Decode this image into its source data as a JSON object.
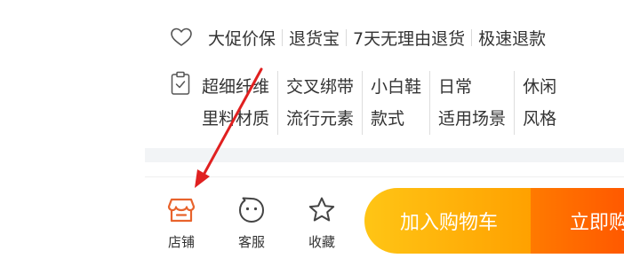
{
  "guarantees": {
    "items": [
      "大促价保",
      "退货宝",
      "7天无理由退货",
      "极速退款"
    ]
  },
  "attributes": [
    {
      "value": "超细纤维",
      "name": "里料材质"
    },
    {
      "value": "交叉绑带",
      "name": "流行元素"
    },
    {
      "value": "小白鞋",
      "name": "款式"
    },
    {
      "value": "日常",
      "name": "适用场景"
    },
    {
      "value": "休闲",
      "name": "风格"
    }
  ],
  "bottom_bar": {
    "store_label": "店铺",
    "service_label": "客服",
    "favorite_label": "收藏",
    "add_to_cart_label": "加入购物车",
    "buy_now_label": "立即购"
  },
  "colors": {
    "store_icon": "#e8632c",
    "cart_gradient_start": "#ffc515",
    "cart_gradient_end": "#ffa000",
    "buy_gradient_start": "#ff7a00",
    "buy_gradient_end": "#ff4e00",
    "annotation_arrow": "#e02020"
  },
  "icons": {
    "guarantee": "heart-icon",
    "attributes": "clipboard-icon",
    "store": "store-icon",
    "service": "customer-service-icon",
    "favorite": "star-icon"
  }
}
